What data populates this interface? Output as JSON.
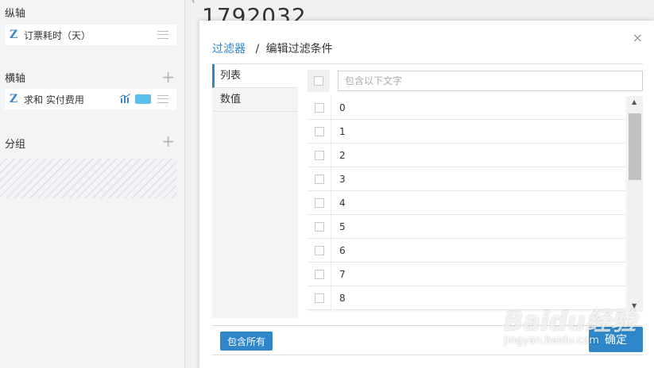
{
  "left_panel": {
    "vertical_axis": {
      "title": "纵轴",
      "field": {
        "type_icon": "Z",
        "label": "订票耗时（天）"
      }
    },
    "horizontal_axis": {
      "title": "横轴",
      "add": "+",
      "field": {
        "type_icon": "Z",
        "label": "求和 实付费用",
        "chart_icon": "bar-line-chart-icon",
        "color": "#5bc0eb"
      }
    },
    "group": {
      "title": "分组",
      "add": "+"
    }
  },
  "background": {
    "big_number": "1792032"
  },
  "dialog": {
    "close": "×",
    "breadcrumb": {
      "link": "过滤器",
      "separator": "/",
      "current": "编辑过滤条件"
    },
    "tabs": [
      {
        "label": "列表",
        "active": true
      },
      {
        "label": "数值",
        "active": false
      }
    ],
    "filter": {
      "placeholder": "包含以下文字"
    },
    "values": [
      "0",
      "1",
      "2",
      "3",
      "4",
      "5",
      "6",
      "7",
      "8"
    ],
    "include_all_label": "包含所有",
    "confirm_label": "确定",
    "accent_color": "#2f86c8"
  },
  "watermark": {
    "logo": "Baidu经验",
    "url": "jingyan.baidu.com"
  }
}
